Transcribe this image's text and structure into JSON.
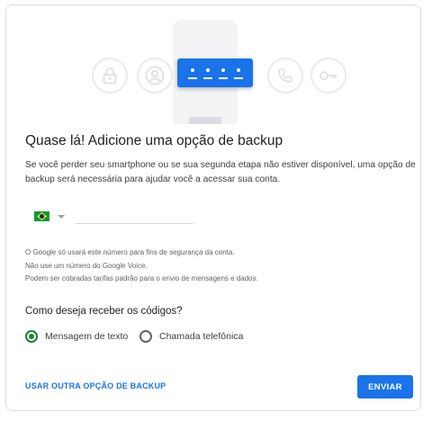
{
  "hero": {
    "icons": [
      "lock-icon",
      "account-icon",
      "phone-call-icon",
      "key-icon"
    ],
    "accent_color": "#1a73e8"
  },
  "title": "Quase lá! Adicione uma opção de backup",
  "description": "Se você perder seu smartphone ou se sua segunda etapa não estiver disponível, uma opção de backup será necessária para ajudar você a acessar sua conta.",
  "phone": {
    "country_flag": "brazil-flag-icon",
    "value": "",
    "placeholder": ""
  },
  "notes": [
    "O Google só usará este número para fins de segurança da conta.",
    "Não use um número do Google Voice.",
    "Podem ser cobradas tarifas padrão para o envio de mensagens e dados."
  ],
  "question": "Como deseja receber os códigos?",
  "options": [
    {
      "label": "Mensagem de texto",
      "selected": true
    },
    {
      "label": "Chamada telefônica",
      "selected": false
    }
  ],
  "actions": {
    "backup_link": "USAR OUTRA OPÇÃO DE BACKUP",
    "send_button": "ENVIAR"
  }
}
